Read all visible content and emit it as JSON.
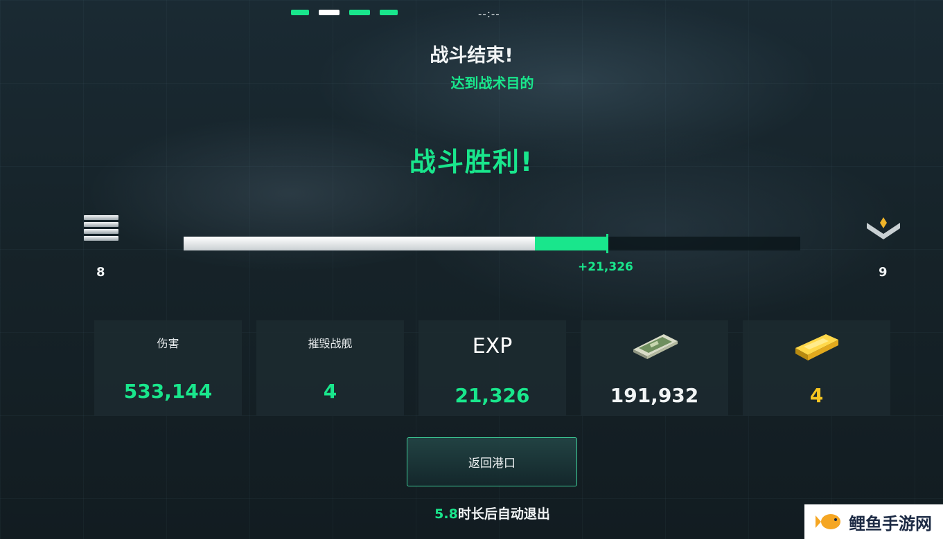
{
  "header": {
    "timer": "--:--",
    "title": "战斗结束!",
    "subtitle": "达到战术目的",
    "result": "战斗胜利!"
  },
  "progress": {
    "level_current": "8",
    "level_next": "9",
    "before_fraction": 0.57,
    "after_fraction": 0.686,
    "gain_label": "+21,326"
  },
  "stats": [
    {
      "label": "伤害",
      "value": "533,144"
    },
    {
      "label": "摧毁战舰",
      "value": "4"
    },
    {
      "label": "EXP",
      "value": "21,326"
    },
    {
      "icon": "cash-icon",
      "value": "191,932"
    },
    {
      "icon": "gold-bar-icon",
      "value": "4"
    }
  ],
  "actions": {
    "return_label": "返回港口",
    "auto_exit_seconds": "5.8",
    "auto_exit_text": "时长后自动退出"
  },
  "watermark": {
    "text": "鲤鱼手游网"
  },
  "colors": {
    "accent": "#19e68c",
    "gold": "#f6c521",
    "card_bg": "#1c2a30"
  }
}
